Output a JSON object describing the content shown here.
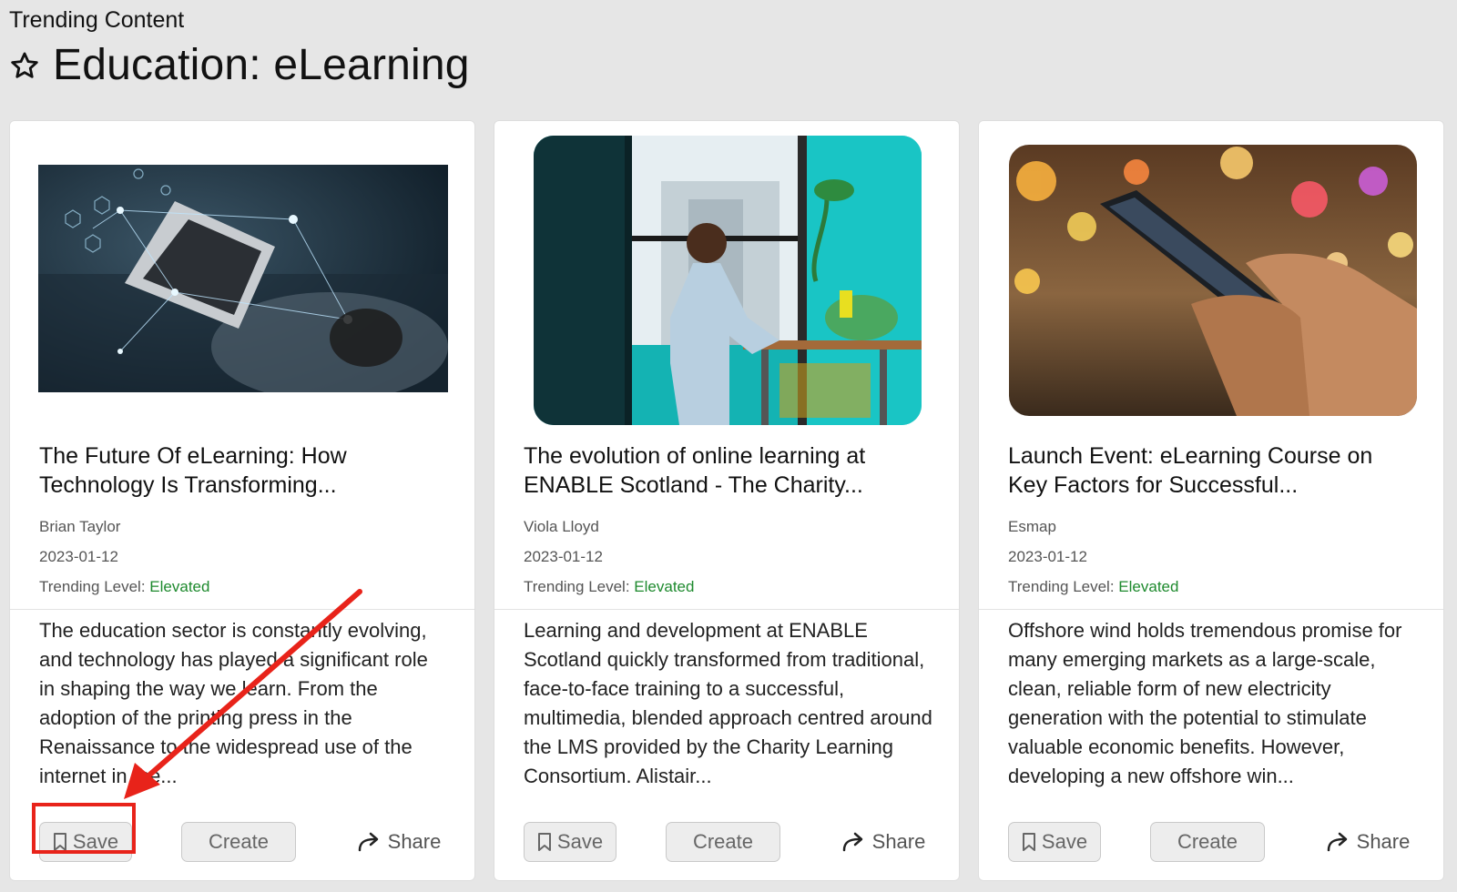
{
  "header": {
    "eyebrow": "Trending Content",
    "title": "Education: eLearning",
    "star_icon": "star-outline-icon"
  },
  "level_label": "Trending Level:",
  "actions": {
    "save_label": "Save",
    "create_label": "Create",
    "share_label": "Share"
  },
  "cards": [
    {
      "title": "The Future Of eLearning: How Technology Is Transforming...",
      "author": "Brian Taylor",
      "date": "2023-01-12",
      "level": "Elevated",
      "excerpt": "The education sector is constantly evolving, and technology has played a significant role in shaping the way we learn. From the adoption of the printing press in the Renaissance to the widespread use of the internet in the..."
    },
    {
      "title": "The evolution of online learning at ENABLE Scotland - The Charity...",
      "author": "Viola Lloyd",
      "date": "2023-01-12",
      "level": "Elevated",
      "excerpt": "Learning and development at ENABLE Scotland quickly transformed from traditional, face-to-face training to a successful, multimedia, blended approach centred around the LMS provided by the Charity Learning Consortium. Alistair..."
    },
    {
      "title": "Launch Event: eLearning Course on Key Factors for Successful...",
      "author": "Esmap",
      "date": "2023-01-12",
      "level": "Elevated",
      "excerpt": "Offshore wind holds tremendous promise for many emerging markets as a large-scale, clean, reliable form of new electricity generation with the potential to stimulate valuable economic benefits. However, developing a new offshore win..."
    }
  ],
  "colors": {
    "level_elevated": "#1e8a2e",
    "annotation": "#e8231a",
    "background": "#e6e6e6"
  }
}
